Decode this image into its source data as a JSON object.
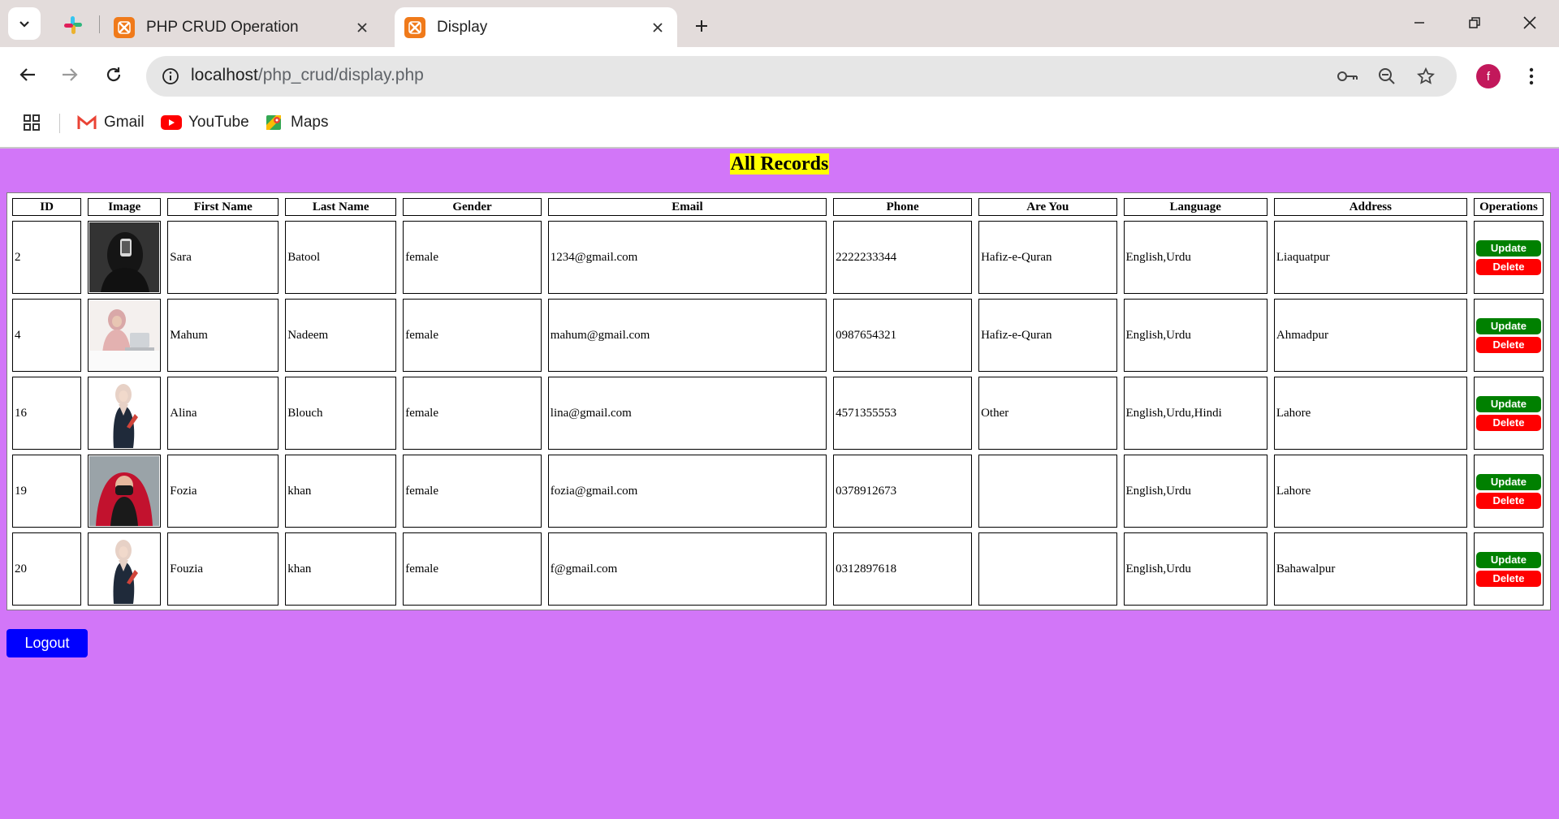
{
  "browser": {
    "tabs": [
      {
        "title": "PHP CRUD Operation",
        "active": false
      },
      {
        "title": "Display",
        "active": true
      }
    ],
    "url_host": "localhost",
    "url_path": "/php_crud/display.php",
    "profile_initial": "f",
    "bookmarks": [
      {
        "label": "Gmail",
        "icon": "gmail-icon"
      },
      {
        "label": "YouTube",
        "icon": "youtube-icon"
      },
      {
        "label": "Maps",
        "icon": "maps-icon"
      }
    ]
  },
  "page": {
    "heading": "All Records",
    "columns": [
      "ID",
      "Image",
      "First Name",
      "Last Name",
      "Gender",
      "Email",
      "Phone",
      "Are You",
      "Language",
      "Address",
      "Operations"
    ],
    "rows": [
      {
        "id": "2",
        "image": "dark-veiled-photo",
        "first_name": "Sara",
        "last_name": "Batool",
        "gender": "female",
        "email": "1234@gmail.com",
        "phone": "2222233344",
        "are_you": "Hafiz-e-Quran",
        "language": "English,Urdu",
        "address": "Liaquatpur"
      },
      {
        "id": "4",
        "image": "woman-at-laptop-photo",
        "first_name": "Mahum",
        "last_name": "Nadeem",
        "gender": "female",
        "email": "mahum@gmail.com",
        "phone": "0987654321",
        "are_you": "Hafiz-e-Quran",
        "language": "English,Urdu",
        "address": "Ahmadpur"
      },
      {
        "id": "16",
        "image": "hijab-girl-photo",
        "first_name": "Alina",
        "last_name": "Blouch",
        "gender": "female",
        "email": "lina@gmail.com",
        "phone": "4571355553",
        "are_you": "Other",
        "language": "English,Urdu,Hindi",
        "address": "Lahore"
      },
      {
        "id": "19",
        "image": "red-hijab-photo",
        "first_name": "Fozia",
        "last_name": "khan",
        "gender": "female",
        "email": "fozia@gmail.com",
        "phone": "0378912673",
        "are_you": "",
        "language": "English,Urdu",
        "address": "Lahore"
      },
      {
        "id": "20",
        "image": "hijab-girl-photo",
        "first_name": "Fouzia",
        "last_name": "khan",
        "gender": "female",
        "email": "f@gmail.com",
        "phone": "0312897618",
        "are_you": "",
        "language": "English,Urdu",
        "address": "Bahawalpur"
      }
    ],
    "update_label": "Update",
    "delete_label": "Delete",
    "logout_label": "Logout"
  },
  "colors": {
    "page_bg": "#d276f8",
    "heading_highlight": "#ffff00",
    "update_btn": "#008000",
    "delete_btn": "#ff0000",
    "logout_btn": "#0000ff"
  }
}
